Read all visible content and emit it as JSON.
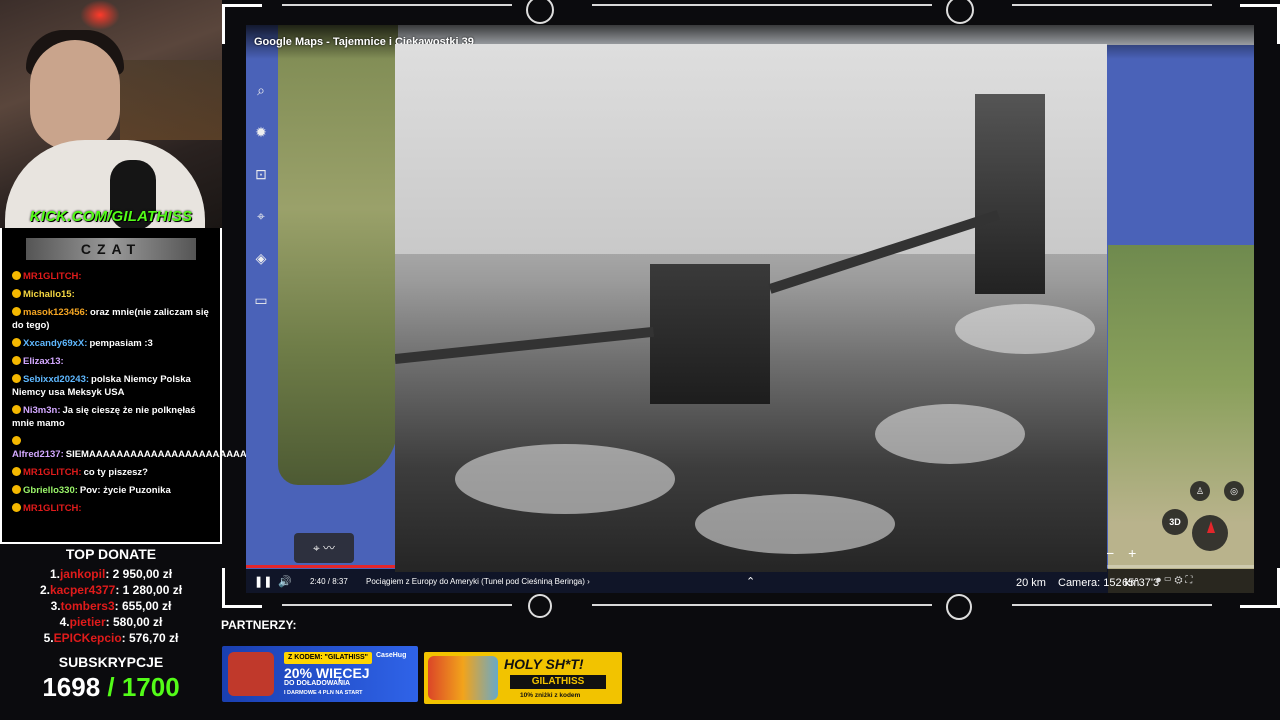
{
  "stream": {
    "kick_url": "KICK.COM/GILATHISS"
  },
  "chat": {
    "title": "CZAT",
    "messages": [
      {
        "user": "MR1GLITCH:",
        "text": "",
        "user_color": "#e01b1b"
      },
      {
        "user": "Michallo15:",
        "text": "",
        "user_color": "#f5d742"
      },
      {
        "user": "masok123456:",
        "text": "oraz mnie(nie zaliczam się do tego)",
        "user_color": "#f5a623"
      },
      {
        "user": "Xxcandy69xX:",
        "text": "pempasiam :3",
        "user_color": "#5fb8ff"
      },
      {
        "user": "Elizax13:",
        "text": "",
        "user_color": "#d3a8ff"
      },
      {
        "user": "Sebixxd20243:",
        "text": "polska Niemcy Polska Niemcy usa Meksyk USA",
        "user_color": "#5fb8ff"
      },
      {
        "user": "Ni3m3n:",
        "text": "Ja się cieszę że nie polknęłaś mnie mamo",
        "user_color": "#d3a8ff"
      },
      {
        "user": "Alfred2137:",
        "text": "SIEMAAAAAAAAAAAAAAAAAAAAAAAAAAAAAAAAAAAAAAAAAAAAAAAAA",
        "user_color": "#d3a8ff"
      },
      {
        "user": "MR1GLITCH:",
        "text": "co ty piszesz?",
        "user_color": "#e01b1b"
      },
      {
        "user": "Gbriello330:",
        "text": "Pov: życie Puzonika",
        "user_color": "#9bf56a"
      },
      {
        "user": "MR1GLITCH:",
        "text": "",
        "user_color": "#e01b1b"
      }
    ]
  },
  "top_donate": {
    "title": "TOP DONATE",
    "entries": [
      {
        "rank": "1.",
        "name": "jankopil",
        "amount": ": 2 950,00 zł"
      },
      {
        "rank": "2.",
        "name": "kacper4377",
        "amount": ": 1 280,00 zł"
      },
      {
        "rank": "3.",
        "name": "tombers3",
        "amount": ": 655,00 zł"
      },
      {
        "rank": "4.",
        "name": "pietier",
        "amount": ": 580,00 zł"
      },
      {
        "rank": "5.",
        "name": "EPICKepcio",
        "amount": ": 576,70 zł"
      }
    ]
  },
  "subs": {
    "label": "SUBSKRYPCJE",
    "count": "1698",
    "goal": " / 1700"
  },
  "map": {
    "title": "Google Maps - Tajemnice i Ciekawostki 39",
    "tools": [
      "search-icon",
      "settings-icon",
      "voyager-icon",
      "pin-icon",
      "layers-icon",
      "ruler-icon"
    ],
    "tool_glyphs": [
      "⌕",
      "✹",
      "⊡",
      "⌖",
      "◈",
      "▭"
    ],
    "time": "2:40 / 8:37",
    "chapter": "Pociągiem z Europy do Ameryki (Tunel pod Cieśniną Beringa) ›",
    "scale": "20 km",
    "camera": "Camera: 152 km",
    "coords": "65°37'3",
    "progress_percent": 31,
    "btn_3d": "3D",
    "zoom_minus": "−",
    "zoom_plus": "+"
  },
  "partners": {
    "label": "PARTNERZY:",
    "banner1": {
      "code": "Z KODEM: \"GILATHISS\"",
      "brand": "CaseHug",
      "headline": "20% WIĘCEJ",
      "sub": "DO DOŁADOWANIA",
      "sub2": "I DARMOWE 4 PLN NA START"
    },
    "banner2": {
      "headline": "HOLY SH*T!",
      "code": "GILATHISS",
      "sub": "10% zniżki z kodem"
    }
  },
  "colors": {
    "kick_green": "#53fc18",
    "donor_red": "#e01b1b",
    "map_water": "#4a62b8",
    "progress_red": "#e3262b"
  }
}
